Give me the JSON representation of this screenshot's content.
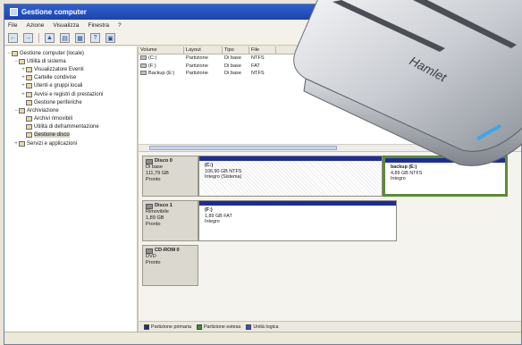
{
  "window": {
    "title": "Gestione computer"
  },
  "menu": [
    "File",
    "Azione",
    "Visualizza",
    "Finestra",
    "?"
  ],
  "tree": [
    {
      "label": "Gestione computer (locale)",
      "level": 0,
      "exp": "−"
    },
    {
      "label": "Utilità di sistema",
      "level": 1,
      "exp": "−"
    },
    {
      "label": "Visualizzatore Eventi",
      "level": 2,
      "exp": "+"
    },
    {
      "label": "Cartelle condivise",
      "level": 2,
      "exp": "+"
    },
    {
      "label": "Utenti e gruppi locali",
      "level": 2,
      "exp": "+"
    },
    {
      "label": "Avvisi e registri di prestazioni",
      "level": 2,
      "exp": "+"
    },
    {
      "label": "Gestione periferiche",
      "level": 2,
      "exp": ""
    },
    {
      "label": "Archiviazione",
      "level": 1,
      "exp": "−"
    },
    {
      "label": "Archivi rimovibili",
      "level": 2,
      "exp": ""
    },
    {
      "label": "Utilità di deframmentazione",
      "level": 2,
      "exp": ""
    },
    {
      "label": "Gestione disco",
      "level": 2,
      "exp": "",
      "selected": true
    },
    {
      "label": "Servizi e applicazioni",
      "level": 1,
      "exp": "+"
    }
  ],
  "list": {
    "columns": [
      "Volume",
      "Layout",
      "Tipo",
      "File"
    ],
    "rows": [
      [
        "(C:)",
        "Partizione",
        "Di base",
        "NTFS"
      ],
      [
        "(F:)",
        "Partizione",
        "Di base",
        "FAT"
      ],
      [
        "Backup (E:)",
        "Partizione",
        "Di base",
        "NTFS"
      ]
    ]
  },
  "disks": [
    {
      "name": "Disco 0",
      "type": "Di base",
      "size": "111,79 GB",
      "status": "Pronto",
      "partitions": [
        {
          "name": "(C:)",
          "detail": "106,90 GB NTFS",
          "status": "Integro (Sistema)",
          "style": "hatched"
        },
        {
          "name": "backup (E:)",
          "detail": "4,89 GB NTFS",
          "status": "Integro",
          "style": "green"
        }
      ]
    },
    {
      "name": "Disco 1",
      "type": "Rimovibile",
      "size": "1,89 GB",
      "status": "Pronto",
      "partitions": [
        {
          "name": "(F:)",
          "detail": "1,89 GB FAT",
          "status": "Integro",
          "style": "plain"
        }
      ]
    },
    {
      "name": "CD-ROM 0",
      "type": "DVD",
      "size": "",
      "status": "Pronto",
      "partitions": []
    }
  ],
  "legend": [
    {
      "label": "Partizione primaria",
      "color": "#1d2c9c"
    },
    {
      "label": "Partizione estesa",
      "color": "#3f8f3a"
    },
    {
      "label": "Unità logica",
      "color": "#3452c9"
    }
  ],
  "drive": {
    "brand": "Hamlet"
  }
}
